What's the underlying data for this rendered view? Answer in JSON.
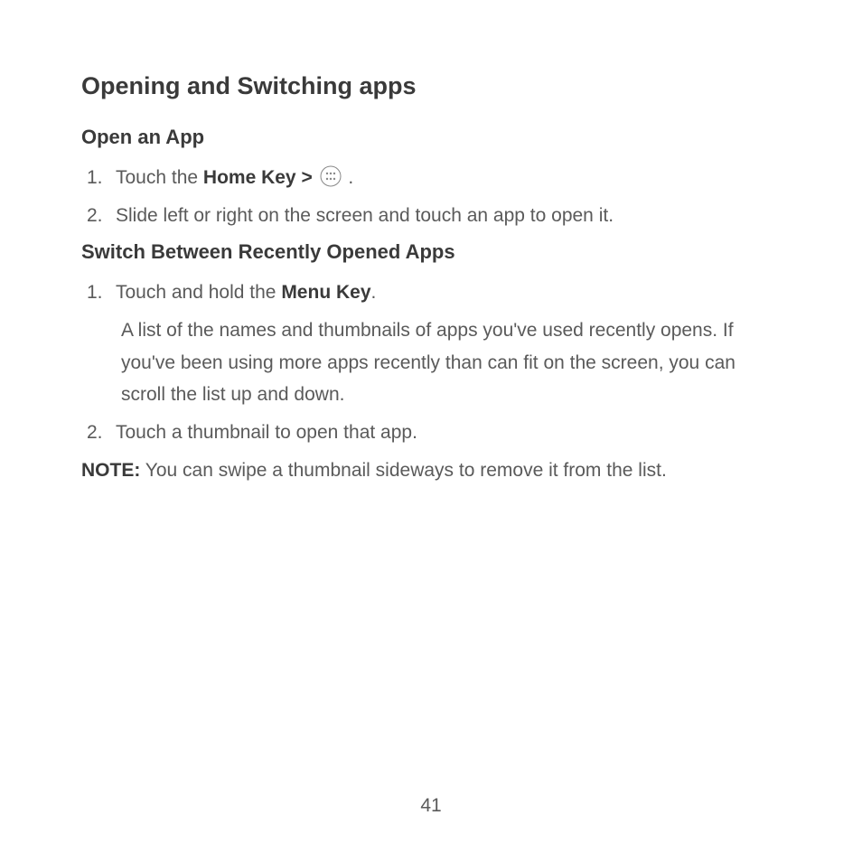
{
  "heading_main": "Opening and Switching apps",
  "section1": {
    "heading": "Open an App",
    "item1_num": "1.",
    "item1_pre": "Touch the ",
    "item1_bold": "Home Key > ",
    "item1_post": " .",
    "item2_num": "2.",
    "item2_text": "Slide left or right on the screen and touch an app to open it."
  },
  "section2": {
    "heading": "Switch Between Recently Opened Apps",
    "item1_num": "1.",
    "item1_pre": "Touch and hold the ",
    "item1_bold": "Menu Key",
    "item1_post": ".",
    "item1_detail": "A list of the names and thumbnails of apps you've used recently opens. If you've been using more apps recently than can fit on the screen, you can scroll the list up and down.",
    "item2_num": "2.",
    "item2_text": "Touch a thumbnail to open that app."
  },
  "note_label": "NOTE:",
  "note_text": " You can swipe a thumbnail sideways to remove it from the list.",
  "page_number": "41"
}
